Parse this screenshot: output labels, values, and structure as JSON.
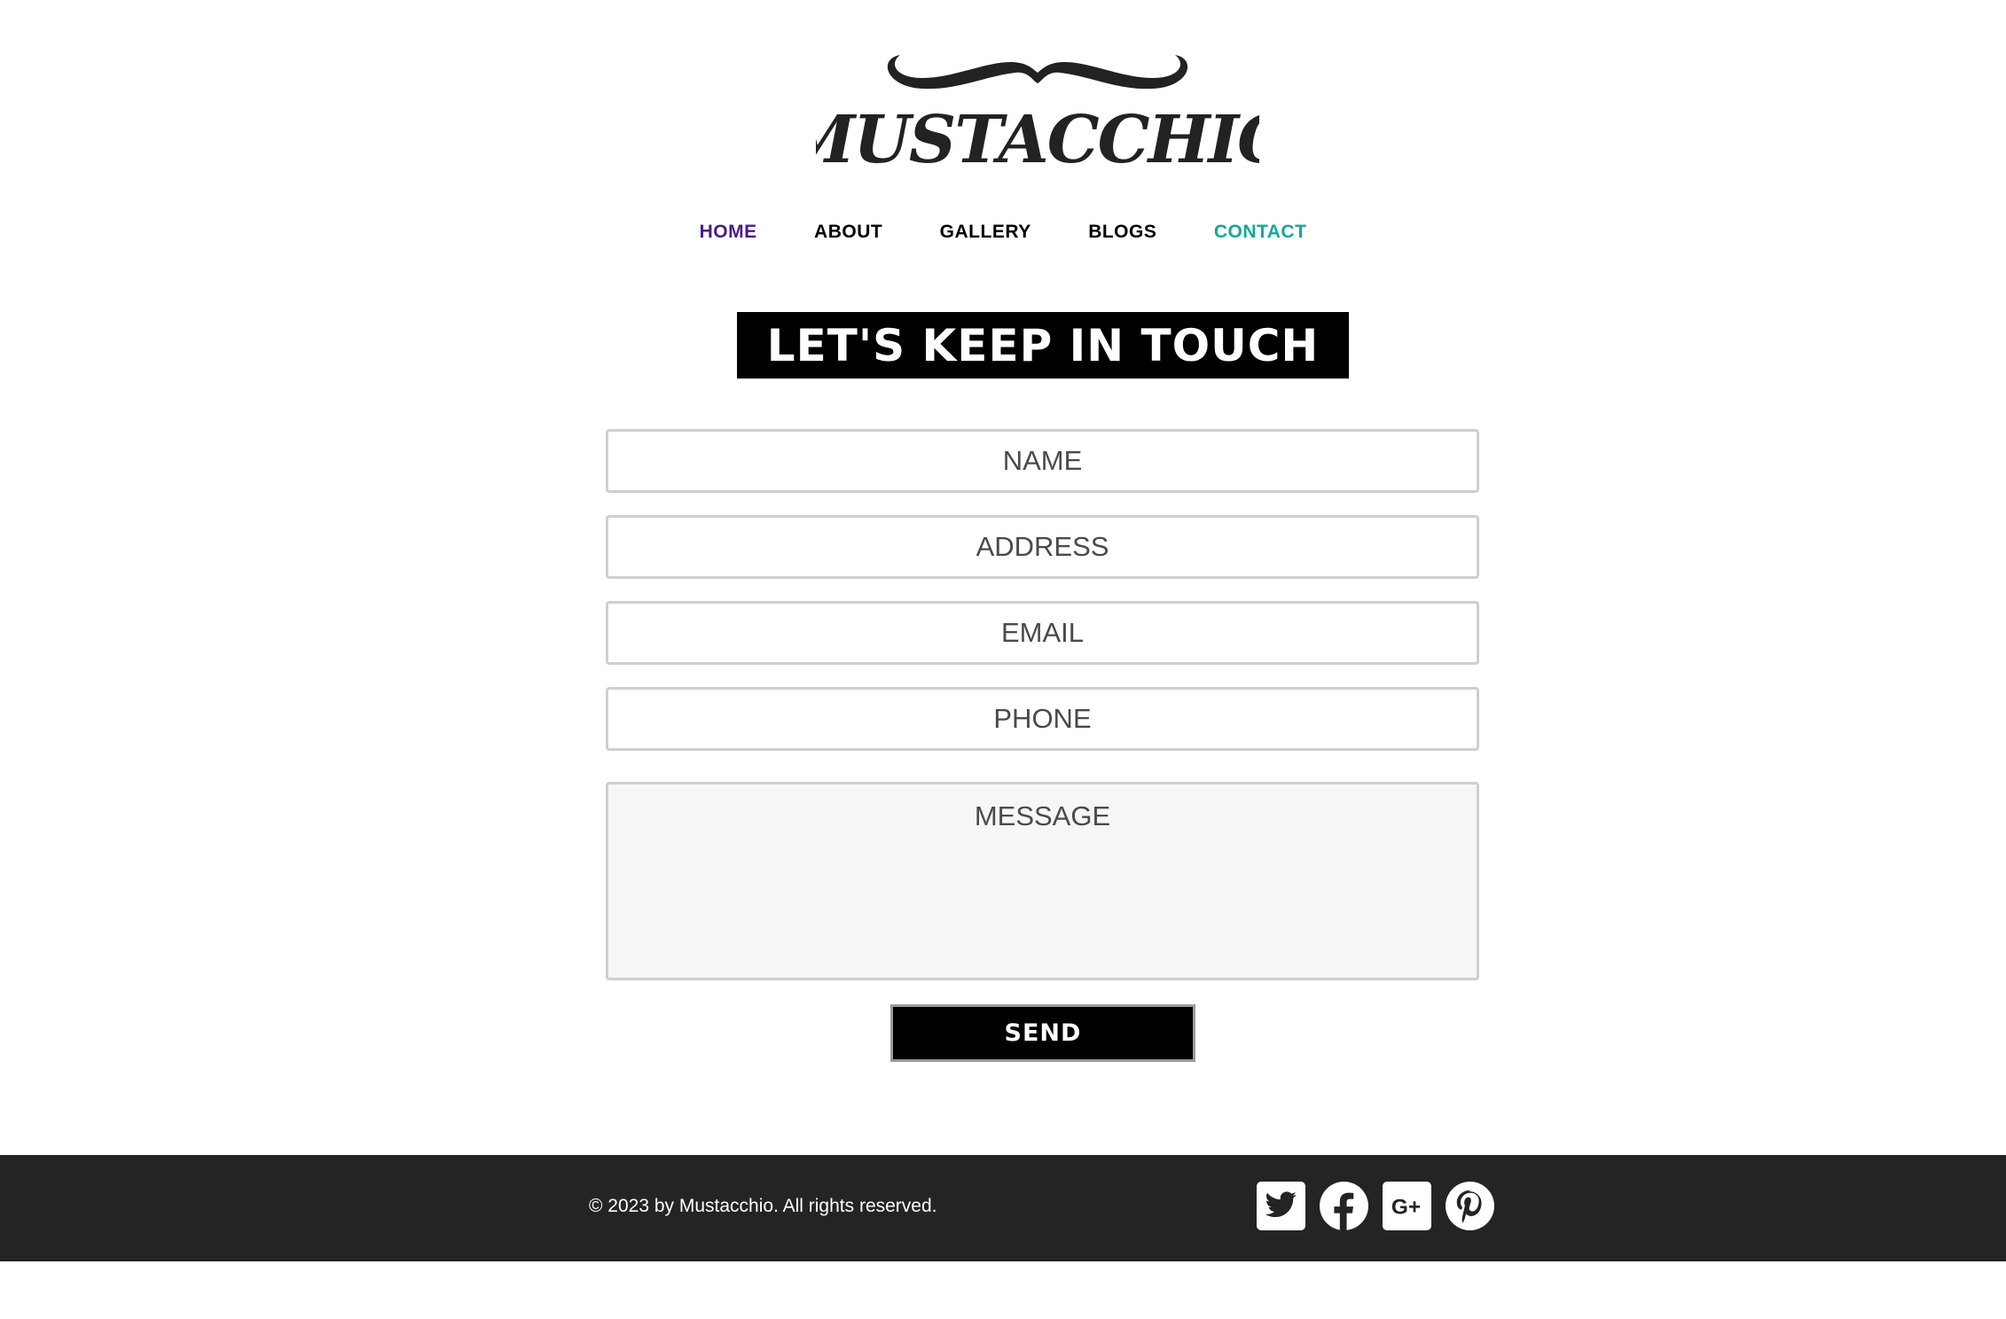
{
  "logo": {
    "text": "MUSTACCHIO"
  },
  "nav": {
    "items": [
      {
        "label": "HOME",
        "color": "#4a1a8a"
      },
      {
        "label": "ABOUT",
        "color": "#000000"
      },
      {
        "label": "GALLERY",
        "color": "#000000"
      },
      {
        "label": "BLOGS",
        "color": "#000000"
      },
      {
        "label": "CONTACT",
        "color": "#14a89a"
      }
    ]
  },
  "heading": {
    "text": "LET'S KEEP IN TOUCH"
  },
  "form": {
    "name_placeholder": "NAME",
    "address_placeholder": "ADDRESS",
    "email_placeholder": "EMAIL",
    "phone_placeholder": "PHONE",
    "message_placeholder": "MESSAGE",
    "send_label": "SEND"
  },
  "footer": {
    "copyright": "© 2023 by Mustacchio. All rights reserved.",
    "social_icons": [
      "twitter-icon",
      "facebook-icon",
      "google-plus-icon",
      "pinterest-icon"
    ],
    "background": "#242424"
  }
}
